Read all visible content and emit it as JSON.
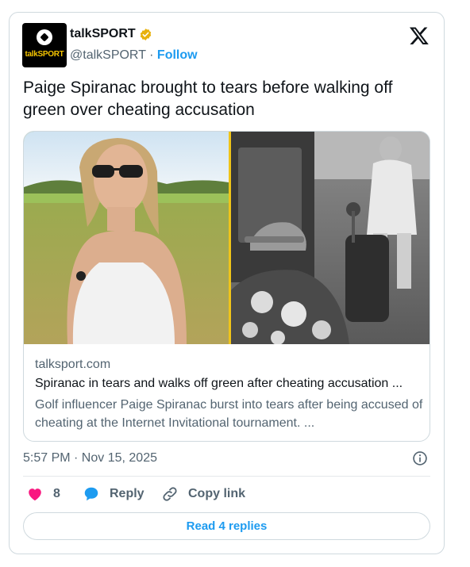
{
  "account": {
    "name": "talkSPORT",
    "handle": "@talkSPORT",
    "separator": "·",
    "follow_label": "Follow",
    "avatar_logo_text": "talkSPORT",
    "verified_color": "#e8b10b"
  },
  "tweet": {
    "text": "Paige Spiranac brought to tears before walking off green over cheating accusation",
    "timestamp": "5:57 PM · Nov 15, 2025"
  },
  "link_card": {
    "domain": "talksport.com",
    "title": "Spiranac in tears and walks off green after cheating accusation ...",
    "description": "Golf influencer Paige Spiranac burst into tears after being accused of cheating at the Internet Invitational tournament. ..."
  },
  "actions": {
    "like_count": "8",
    "reply_label": "Reply",
    "copy_link_label": "Copy link"
  },
  "read_replies_label": "Read 4 replies",
  "colors": {
    "accent": "#1d9bf0",
    "like": "#f91880",
    "text_secondary": "#536471",
    "border": "#cfd9de"
  },
  "icons": [
    "verified-badge-icon",
    "x-logo-icon",
    "info-icon",
    "heart-icon",
    "reply-bubble-icon",
    "link-icon"
  ]
}
